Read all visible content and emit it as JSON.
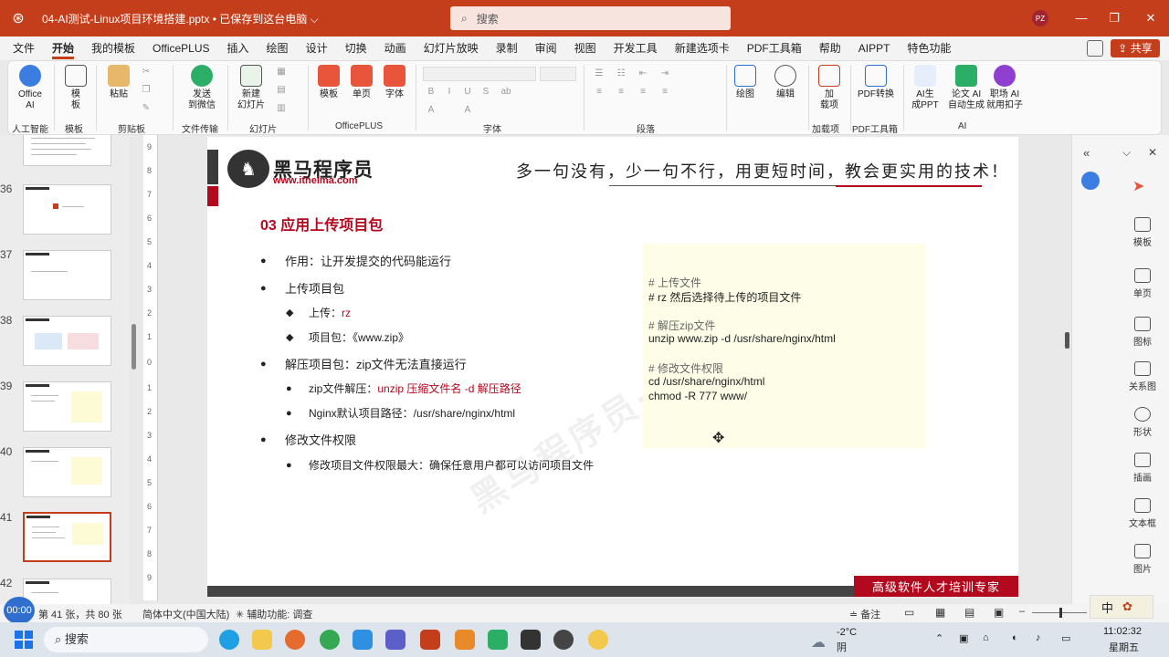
{
  "titlebar": {
    "doc_title": "04-AI测试-Linux项目环境搭建.pptx • 已保存到这台电脑 ⌵",
    "search_placeholder": "搜索",
    "avatar": "PZ"
  },
  "menu": [
    "文件",
    "开始",
    "我的模板",
    "OfficePLUS",
    "插入",
    "绘图",
    "设计",
    "切换",
    "动画",
    "幻灯片放映",
    "录制",
    "审阅",
    "视图",
    "开发工具",
    "新建选项卡",
    "PDF工具箱",
    "帮助",
    "AIPPT",
    "特色功能"
  ],
  "share_label": "共享",
  "ribbon": {
    "office_ai": "Office\nAI",
    "template": "模\n板",
    "paste": "粘贴",
    "send_wechat": "发送\n到微信",
    "new_slide": "新建\n幻灯片",
    "officeplus_template": "模板",
    "single_page": "单页",
    "font_btn": "字体",
    "draw": "绘图",
    "edit": "编辑",
    "addin": "加\n载项",
    "pdf_convert": "PDF转换",
    "ai_ppt": "AI生\n成PPT",
    "paper_ai": "论文 AI\n自动生成",
    "career_ai": "职场 AI\n就用扣子",
    "groups": {
      "ai": "人工智能",
      "template": "模板",
      "clipboard": "剪贴板",
      "file_transfer": "文件传输",
      "slides": "幻灯片",
      "officeplus": "OfficePLUS",
      "font": "字体",
      "paragraph": "段落",
      "addin": "加载项",
      "pdf": "PDF工具箱",
      "ai2": "AI"
    }
  },
  "thumbnails": {
    "numbers": [
      "36",
      "37",
      "38",
      "39",
      "40",
      "41",
      "42"
    ]
  },
  "ruler_numbers": [
    "9",
    "8",
    "7",
    "6",
    "5",
    "4",
    "3",
    "2",
    "1",
    "0",
    "1",
    "2",
    "3",
    "4",
    "5",
    "6",
    "7",
    "8",
    "9"
  ],
  "slide": {
    "logo_cn": "黑马程序员",
    "logo_url": "www.itheima.com",
    "slogan": "多一句没有，少一句不行，用更短时间，教会更实用的技术！",
    "title": "03 应用上传项目包",
    "bullets": {
      "b1": "作用：让开发提交的代码能运行",
      "b2": "上传项目包",
      "b2_1_prefix": "上传：",
      "b2_1_value": "rz",
      "b2_2": "项目包：《www.zip》",
      "b3": "解压项目包：zip文件无法直接运行",
      "b3_1_prefix": "zip文件解压：",
      "b3_1_value": "unzip 压缩文件名  -d 解压路径",
      "b3_2": "Nginx默认项目路径：/usr/share/nginx/html",
      "b4": "修改文件权限",
      "b4_1": "修改项目文件权限最大：确保任意用户都可以访问项目文件"
    },
    "code": [
      "# 上传文件",
      "# rz   然后选择待上传的项目文件",
      "# 解压zip文件",
      "unzip www.zip -d /usr/share/nginx/html",
      "# 修改文件权限",
      "cd /usr/share/nginx/html",
      "chmod -R  777  www/"
    ],
    "watermark": "黑马程序员·软",
    "footer": "高级软件人才培训专家"
  },
  "side_panel": [
    "模板",
    "单页",
    "图标",
    "关系图",
    "形状",
    "插画",
    "文本框",
    "图片"
  ],
  "status": {
    "timer": "00:00",
    "slide_info": "第 41 张，共 80 张",
    "language": "简体中文(中国大陆)",
    "accessibility": "辅助功能: 调查",
    "notes": "备注"
  },
  "taskbar": {
    "search": "搜索",
    "weather_temp": "-2°C",
    "weather_desc": "阴",
    "time": "11:02:32",
    "day": "星期五",
    "ime": "中"
  }
}
